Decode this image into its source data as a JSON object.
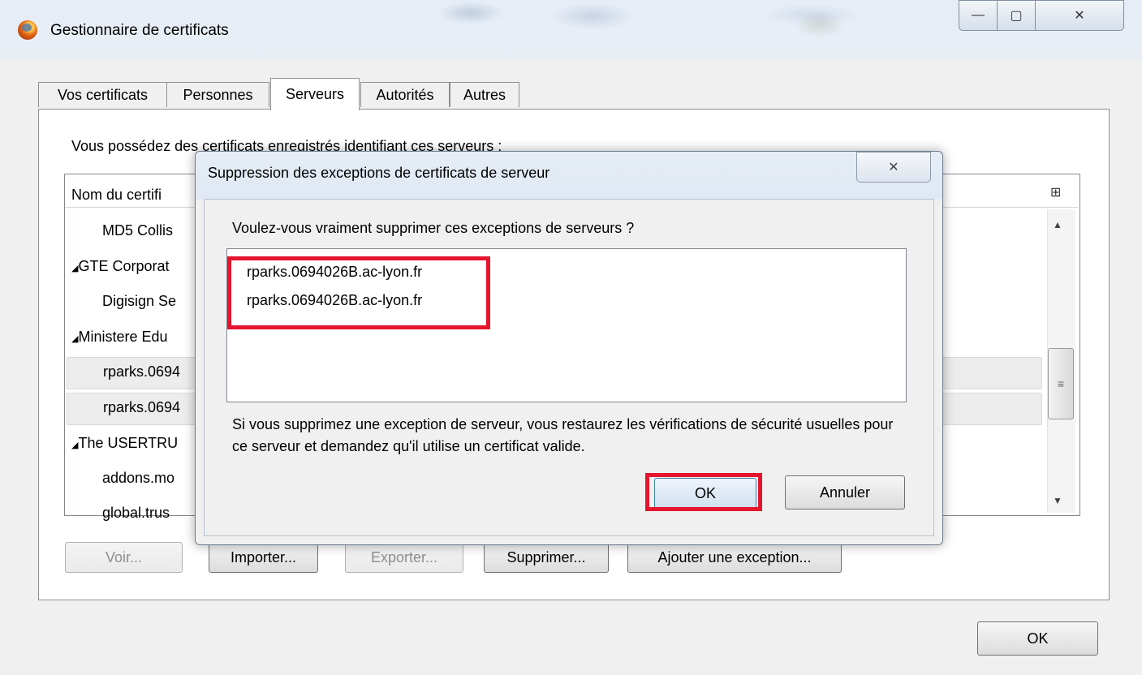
{
  "window": {
    "title": "Gestionnaire de certificats",
    "caption_minimize": "—",
    "caption_maximize": "▢",
    "caption_close": "✕"
  },
  "tabs": [
    {
      "label": "Vos certificats",
      "selected": false
    },
    {
      "label": "Personnes",
      "selected": false
    },
    {
      "label": "Serveurs",
      "selected": true
    },
    {
      "label": "Autorités",
      "selected": false
    },
    {
      "label": "Autres",
      "selected": false
    }
  ],
  "servers_panel": {
    "intro": "Vous possédez des certificats enregistrés identifiant ces serveurs :",
    "column_header": "Nom du certifi",
    "column_picker_icon": "column-picker-icon",
    "rows": [
      {
        "label": "MD5 Collis",
        "indent": 1,
        "expander": ""
      },
      {
        "label": "GTE Corporat",
        "indent": 0,
        "expander": "◢"
      },
      {
        "label": "Digisign Se",
        "indent": 1,
        "expander": ""
      },
      {
        "label": "Ministere Edu",
        "indent": 0,
        "expander": "◢"
      },
      {
        "label": "rparks.0694",
        "indent": 1,
        "expander": "",
        "selected": true
      },
      {
        "label": "rparks.0694",
        "indent": 1,
        "expander": "",
        "selected": true
      },
      {
        "label": "The USERTRU",
        "indent": 0,
        "expander": "◢"
      },
      {
        "label": "addons.mo",
        "indent": 1,
        "expander": ""
      },
      {
        "label": "global.trus",
        "indent": 1,
        "expander": ""
      }
    ],
    "buttons": {
      "view": "Voir...",
      "import": "Importer...",
      "export": "Exporter...",
      "delete": "Supprimer...",
      "add_exception": "Ajouter une exception..."
    }
  },
  "dialog": {
    "title": "Suppression des exceptions de certificats de serveur",
    "close": "✕",
    "question": "Voulez-vous vraiment supprimer ces exceptions de serveurs ?",
    "items": [
      "rparks.0694026B.ac-lyon.fr",
      "rparks.0694026B.ac-lyon.fr"
    ],
    "info": "Si vous supprimez une exception de serveur, vous restaurez les vérifications de sécurité usuelles pour ce serveur et demandez qu'il utilise un certificat valide.",
    "ok": "OK",
    "cancel": "Annuler"
  },
  "footer": {
    "ok": "OK"
  },
  "colors": {
    "highlight": "#e5152d"
  }
}
